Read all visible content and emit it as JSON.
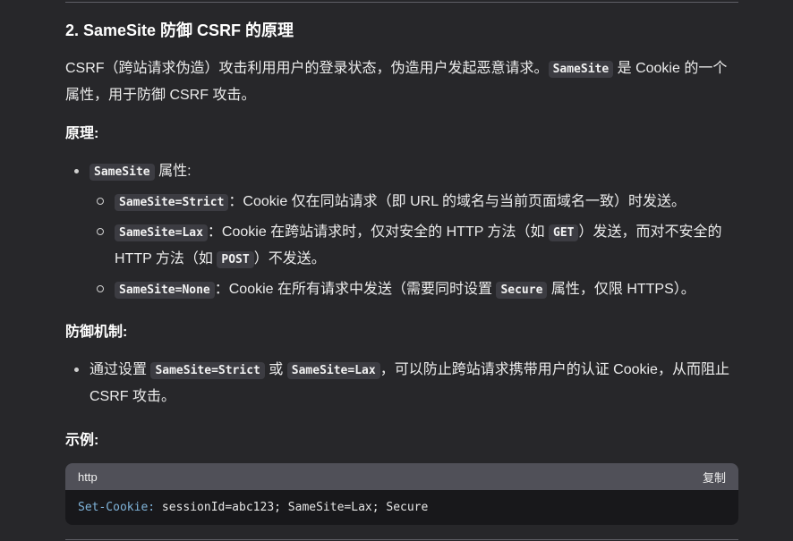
{
  "section": {
    "heading": "2. SameSite 防御 CSRF 的原理",
    "intro": {
      "before": "CSRF（跨站请求伪造）攻击利用用户的登录状态，伪造用户发起恶意请求。",
      "code": "SameSite",
      "after": " 是 Cookie 的一个属性，用于防御 CSRF 攻击。"
    }
  },
  "principle": {
    "label": "原理:",
    "item": {
      "code": "SameSite",
      "text": " 属性:"
    },
    "sub_items": [
      {
        "code": "SameSite=Strict",
        "text": "：Cookie 仅在同站请求（即 URL 的域名与当前页面域名一致）时发送。"
      },
      {
        "code": "SameSite=Lax",
        "text_a": "：Cookie 在跨站请求时，仅对安全的 HTTP 方法（如 ",
        "code_b": "GET",
        "text_b": "）发送，而对不安全的 HTTP 方法（如 ",
        "code_c": "POST",
        "text_c": "）不发送。"
      },
      {
        "code": "SameSite=None",
        "text_a": "：Cookie 在所有请求中发送（需要同时设置 ",
        "code_b": "Secure",
        "text_b": " 属性，仅限 HTTPS）。"
      }
    ]
  },
  "defense": {
    "label": "防御机制:",
    "item": {
      "text_a": "通过设置 ",
      "code_a": "SameSite=Strict",
      "text_b": " 或 ",
      "code_b": "SameSite=Lax",
      "text_c": "，可以防止跨站请求携带用户的认证 Cookie，从而阻止 CSRF 攻击。"
    }
  },
  "example": {
    "label": "示例:",
    "code_block": {
      "language": "http",
      "copy_label": "复制",
      "key": "Set-Cookie:",
      "value": " sessionId=abc123; SameSite=Lax; Secure"
    }
  }
}
